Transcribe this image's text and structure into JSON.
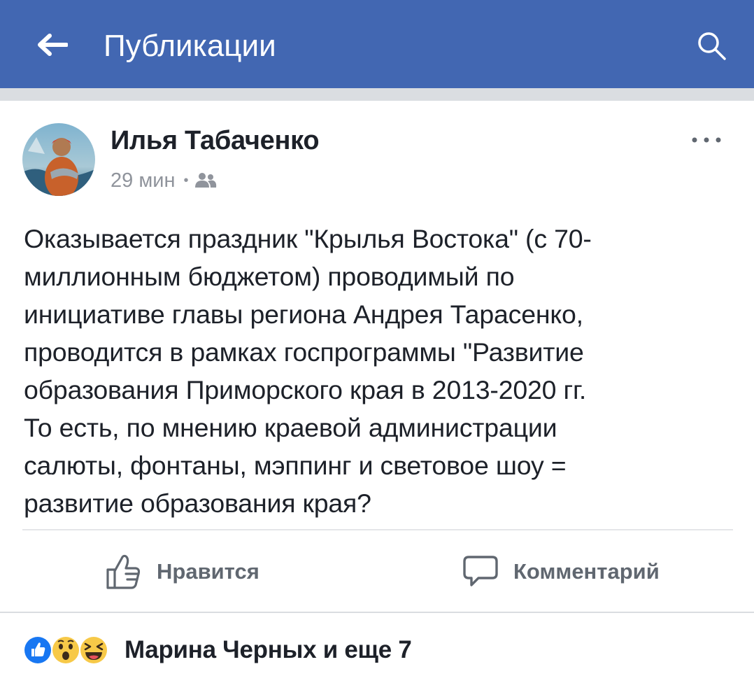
{
  "app": {
    "title": "Публикации",
    "colors": {
      "header": "#4267b2",
      "secondary_text": "#90949c",
      "action_text": "#606770"
    }
  },
  "header": {
    "back_icon": "arrow-left-icon",
    "search_icon": "search-icon"
  },
  "post": {
    "author": "Илья Табаченко",
    "time": "29 мин",
    "separator": "•",
    "audience_icon": "friends-icon",
    "more_icon": "more-horizontal-icon",
    "text": "Оказывается праздник \"Крылья Востока\" (с 70-\nмиллионным бюджетом) проводимый по\nинициативе главы региона Андрея Тарасенко,\nпроводится в рамках госпрограммы \"Развитие\nобразования Приморского края в 2013-2020 гг.\nТо есть, по мнению краевой администрации\nсалюты, фонтаны, мэппинг и световое шоу =\nразвитие образования края?",
    "actions": {
      "like_label": "Нравится",
      "like_icon": "thumbs-up-icon",
      "comment_label": "Комментарий",
      "comment_icon": "comment-bubble-icon"
    },
    "reactions": {
      "icons": [
        "like-reaction-icon",
        "wow-reaction-icon",
        "haha-reaction-icon"
      ],
      "summary": "Марина Черных и еще 7"
    }
  }
}
